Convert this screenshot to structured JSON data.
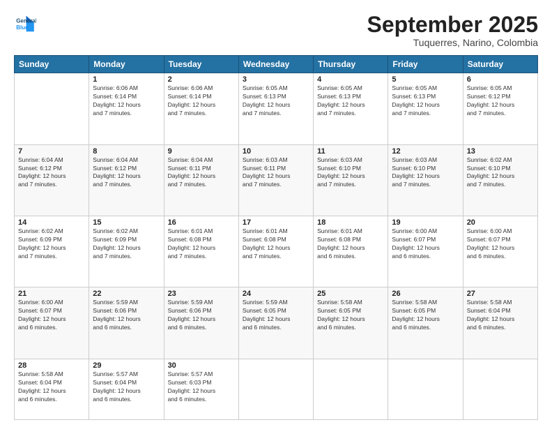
{
  "logo": {
    "line1": "General",
    "line2": "Blue"
  },
  "title": "September 2025",
  "location": "Tuquerres, Narino, Colombia",
  "weekdays": [
    "Sunday",
    "Monday",
    "Tuesday",
    "Wednesday",
    "Thursday",
    "Friday",
    "Saturday"
  ],
  "weeks": [
    [
      {
        "day": "",
        "info": ""
      },
      {
        "day": "1",
        "info": "Sunrise: 6:06 AM\nSunset: 6:14 PM\nDaylight: 12 hours\nand 7 minutes."
      },
      {
        "day": "2",
        "info": "Sunrise: 6:06 AM\nSunset: 6:14 PM\nDaylight: 12 hours\nand 7 minutes."
      },
      {
        "day": "3",
        "info": "Sunrise: 6:05 AM\nSunset: 6:13 PM\nDaylight: 12 hours\nand 7 minutes."
      },
      {
        "day": "4",
        "info": "Sunrise: 6:05 AM\nSunset: 6:13 PM\nDaylight: 12 hours\nand 7 minutes."
      },
      {
        "day": "5",
        "info": "Sunrise: 6:05 AM\nSunset: 6:13 PM\nDaylight: 12 hours\nand 7 minutes."
      },
      {
        "day": "6",
        "info": "Sunrise: 6:05 AM\nSunset: 6:12 PM\nDaylight: 12 hours\nand 7 minutes."
      }
    ],
    [
      {
        "day": "7",
        "info": "Sunrise: 6:04 AM\nSunset: 6:12 PM\nDaylight: 12 hours\nand 7 minutes."
      },
      {
        "day": "8",
        "info": "Sunrise: 6:04 AM\nSunset: 6:12 PM\nDaylight: 12 hours\nand 7 minutes."
      },
      {
        "day": "9",
        "info": "Sunrise: 6:04 AM\nSunset: 6:11 PM\nDaylight: 12 hours\nand 7 minutes."
      },
      {
        "day": "10",
        "info": "Sunrise: 6:03 AM\nSunset: 6:11 PM\nDaylight: 12 hours\nand 7 minutes."
      },
      {
        "day": "11",
        "info": "Sunrise: 6:03 AM\nSunset: 6:10 PM\nDaylight: 12 hours\nand 7 minutes."
      },
      {
        "day": "12",
        "info": "Sunrise: 6:03 AM\nSunset: 6:10 PM\nDaylight: 12 hours\nand 7 minutes."
      },
      {
        "day": "13",
        "info": "Sunrise: 6:02 AM\nSunset: 6:10 PM\nDaylight: 12 hours\nand 7 minutes."
      }
    ],
    [
      {
        "day": "14",
        "info": "Sunrise: 6:02 AM\nSunset: 6:09 PM\nDaylight: 12 hours\nand 7 minutes."
      },
      {
        "day": "15",
        "info": "Sunrise: 6:02 AM\nSunset: 6:09 PM\nDaylight: 12 hours\nand 7 minutes."
      },
      {
        "day": "16",
        "info": "Sunrise: 6:01 AM\nSunset: 6:08 PM\nDaylight: 12 hours\nand 7 minutes."
      },
      {
        "day": "17",
        "info": "Sunrise: 6:01 AM\nSunset: 6:08 PM\nDaylight: 12 hours\nand 7 minutes."
      },
      {
        "day": "18",
        "info": "Sunrise: 6:01 AM\nSunset: 6:08 PM\nDaylight: 12 hours\nand 6 minutes."
      },
      {
        "day": "19",
        "info": "Sunrise: 6:00 AM\nSunset: 6:07 PM\nDaylight: 12 hours\nand 6 minutes."
      },
      {
        "day": "20",
        "info": "Sunrise: 6:00 AM\nSunset: 6:07 PM\nDaylight: 12 hours\nand 6 minutes."
      }
    ],
    [
      {
        "day": "21",
        "info": "Sunrise: 6:00 AM\nSunset: 6:07 PM\nDaylight: 12 hours\nand 6 minutes."
      },
      {
        "day": "22",
        "info": "Sunrise: 5:59 AM\nSunset: 6:06 PM\nDaylight: 12 hours\nand 6 minutes."
      },
      {
        "day": "23",
        "info": "Sunrise: 5:59 AM\nSunset: 6:06 PM\nDaylight: 12 hours\nand 6 minutes."
      },
      {
        "day": "24",
        "info": "Sunrise: 5:59 AM\nSunset: 6:05 PM\nDaylight: 12 hours\nand 6 minutes."
      },
      {
        "day": "25",
        "info": "Sunrise: 5:58 AM\nSunset: 6:05 PM\nDaylight: 12 hours\nand 6 minutes."
      },
      {
        "day": "26",
        "info": "Sunrise: 5:58 AM\nSunset: 6:05 PM\nDaylight: 12 hours\nand 6 minutes."
      },
      {
        "day": "27",
        "info": "Sunrise: 5:58 AM\nSunset: 6:04 PM\nDaylight: 12 hours\nand 6 minutes."
      }
    ],
    [
      {
        "day": "28",
        "info": "Sunrise: 5:58 AM\nSunset: 6:04 PM\nDaylight: 12 hours\nand 6 minutes."
      },
      {
        "day": "29",
        "info": "Sunrise: 5:57 AM\nSunset: 6:04 PM\nDaylight: 12 hours\nand 6 minutes."
      },
      {
        "day": "30",
        "info": "Sunrise: 5:57 AM\nSunset: 6:03 PM\nDaylight: 12 hours\nand 6 minutes."
      },
      {
        "day": "",
        "info": ""
      },
      {
        "day": "",
        "info": ""
      },
      {
        "day": "",
        "info": ""
      },
      {
        "day": "",
        "info": ""
      }
    ]
  ]
}
